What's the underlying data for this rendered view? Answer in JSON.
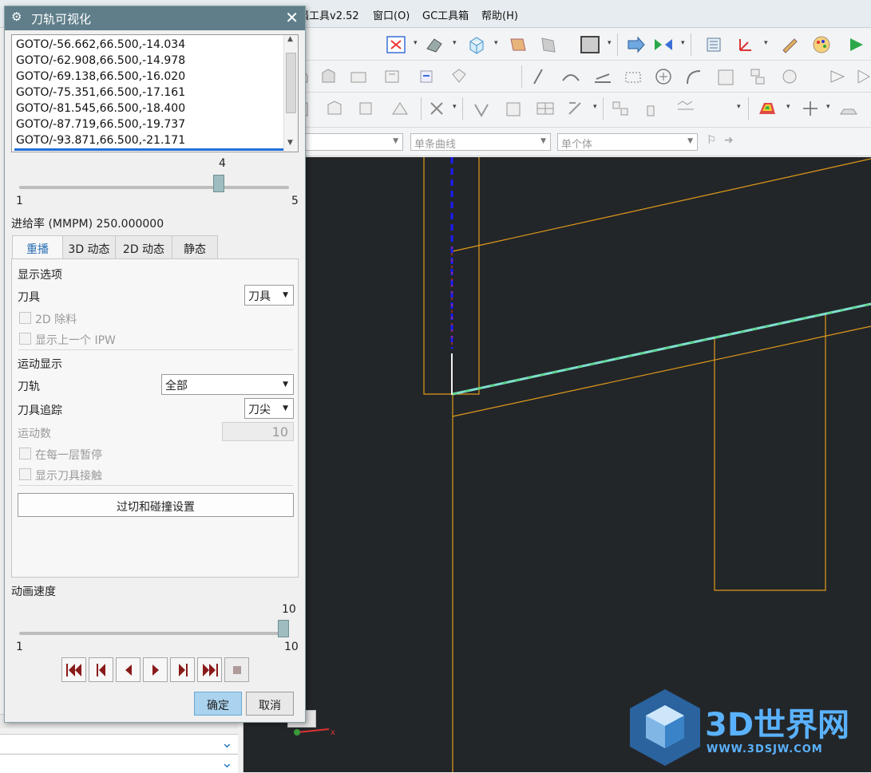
{
  "menubar": {
    "items": [
      "强工具v2.52",
      "窗口(O)",
      "GC工具箱",
      "帮助(H)"
    ]
  },
  "filterbar": {
    "curve_rule": "单条曲线",
    "body_rule": "单个体"
  },
  "dialog": {
    "title": "刀轨可视化",
    "goto_lines": [
      "GOTO/-56.662,66.500,-14.034",
      "GOTO/-62.908,66.500,-14.978",
      "GOTO/-69.138,66.500,-16.020",
      "GOTO/-75.351,66.500,-17.161",
      "GOTO/-81.545,66.500,-18.400",
      "GOTO/-87.719,66.500,-19.737",
      "GOTO/-93.871,66.500,-21.171"
    ],
    "step_slider": {
      "value": "4",
      "min": "1",
      "max": "5",
      "fraction": 0.75
    },
    "feed_rate": "进给率 (MMPM) 250.000000",
    "tabs": [
      "重播",
      "3D 动态",
      "2D 动态",
      "静态"
    ],
    "display_options": {
      "section": "显示选项",
      "tool_label": "刀具",
      "tool_value": "刀具",
      "remove_2d": "2D 除料",
      "show_prev_ipw": "显示上一个 IPW"
    },
    "motion_display": {
      "section": "运动显示",
      "path_label": "刀轨",
      "path_value": "全部",
      "trace_label": "刀具追踪",
      "trace_value": "刀尖",
      "count_label": "运动数",
      "count_value": "10",
      "pause_each_layer": "在每一层暂停",
      "show_contact": "显示刀具接触"
    },
    "gouge_button": "过切和碰撞设置",
    "speed": {
      "label": "动画速度",
      "value": "10",
      "min": "1",
      "max": "10",
      "fraction": 1.0
    },
    "ok": "确定",
    "cancel": "取消"
  },
  "watermark": {
    "brand": "3D世界网",
    "url": "WWW.3DSJW.COM"
  },
  "colors": {
    "title_bar": "#5f7e8a",
    "viewport_bg": "#232629",
    "wireframe": "#e09a1a",
    "toolpath_dashed": "#1a1aff",
    "toolpath_cut": "#7fe0d0",
    "ok_button": "#a9d3ee"
  }
}
